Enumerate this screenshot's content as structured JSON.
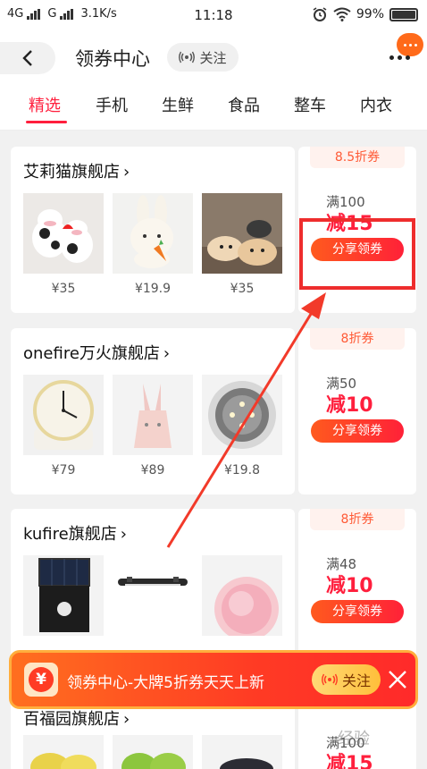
{
  "status_bar": {
    "network_1": "4G",
    "network_2": "G",
    "speed": "3.1K/s",
    "time": "11:18",
    "battery": "99%",
    "battery_level": 0.99,
    "icons": [
      "alarm-icon",
      "wifi-icon",
      "battery-icon"
    ]
  },
  "header": {
    "title": "领券中心",
    "follow_label": "关注",
    "icons": [
      "back-chevron-icon",
      "broadcast-icon",
      "chat-bubble-icon",
      "more-dots-icon"
    ]
  },
  "tabs": [
    {
      "label": "精选",
      "active": true
    },
    {
      "label": "手机",
      "active": false
    },
    {
      "label": "生鲜",
      "active": false
    },
    {
      "label": "食品",
      "active": false
    },
    {
      "label": "整车",
      "active": false
    },
    {
      "label": "内衣",
      "active": false
    }
  ],
  "stores": [
    {
      "name": "艾莉猫旗舰店",
      "products": [
        {
          "price": "¥35",
          "image": "cow-plush-toys"
        },
        {
          "price": "¥19.9",
          "image": "bunny-plush-with-carrot"
        },
        {
          "price": "¥35",
          "image": "cat-plush-pillows"
        }
      ],
      "coupon": {
        "discount": "8.5折券",
        "threshold": "满100",
        "amount": "减15",
        "button": "分享领券"
      }
    },
    {
      "name": "onefire万火旗舰店",
      "products": [
        {
          "price": "¥79",
          "image": "desk-alarm-clock"
        },
        {
          "price": "¥89",
          "image": "pink-rabbit-lamp"
        },
        {
          "price": "¥19.8",
          "image": "round-led-light"
        }
      ],
      "coupon": {
        "discount": "8折券",
        "threshold": "满50",
        "amount": "减10",
        "button": "分享领券"
      }
    },
    {
      "name": "kufire旗舰店",
      "products": [
        {
          "price": "",
          "image": "solar-wall-light"
        },
        {
          "price": "",
          "image": "led-light-bar"
        },
        {
          "price": "",
          "image": "pink-makeup-mirror"
        }
      ],
      "coupon": {
        "discount": "8折券",
        "threshold": "满48",
        "amount": "减10",
        "button": "分享领券"
      }
    },
    {
      "name": "百福园旗舰店",
      "products": [
        {
          "price": "",
          "image": "yellow-fruit"
        },
        {
          "price": "",
          "image": "green-apples"
        },
        {
          "price": "",
          "image": "dark-produce"
        }
      ],
      "coupon": {
        "discount": "",
        "threshold": "满100",
        "amount": "减15",
        "button": ""
      }
    }
  ],
  "banner": {
    "icon_text": "¥",
    "text": "领券中心-大牌5折券天天上新",
    "follow_label": "关注"
  },
  "watermark": "经验"
}
